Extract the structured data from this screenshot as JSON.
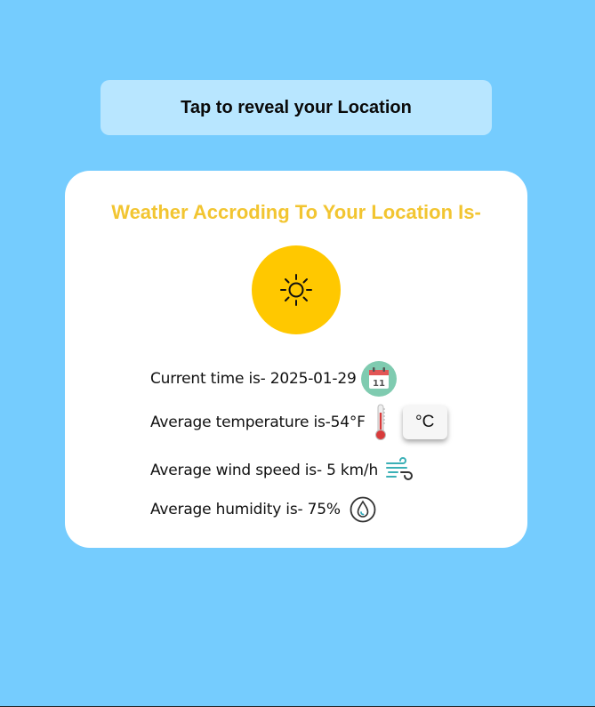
{
  "reveal_button": {
    "label": "Tap to reveal your Location"
  },
  "card": {
    "title": "Weather Accroding To Your Location Is-",
    "weather_icon": "sun-icon",
    "time": {
      "text": "Current time is- 2025-01-29",
      "icon": "calendar-icon",
      "calendar_day": "11"
    },
    "temperature": {
      "text": "Average temperature is-54°F",
      "icon": "thermometer-icon",
      "unit_toggle": "°C"
    },
    "wind": {
      "text": "Average wind speed is- 5 km/h",
      "icon": "wind-icon"
    },
    "humidity": {
      "text": "Average humidity is- 75%",
      "icon": "humidity-drop-icon"
    }
  },
  "colors": {
    "background": "#75ccfe",
    "button_bg": "#b8e6ff",
    "card_bg": "#ffffff",
    "title": "#f2c531",
    "sun_circle": "#ffc800"
  }
}
